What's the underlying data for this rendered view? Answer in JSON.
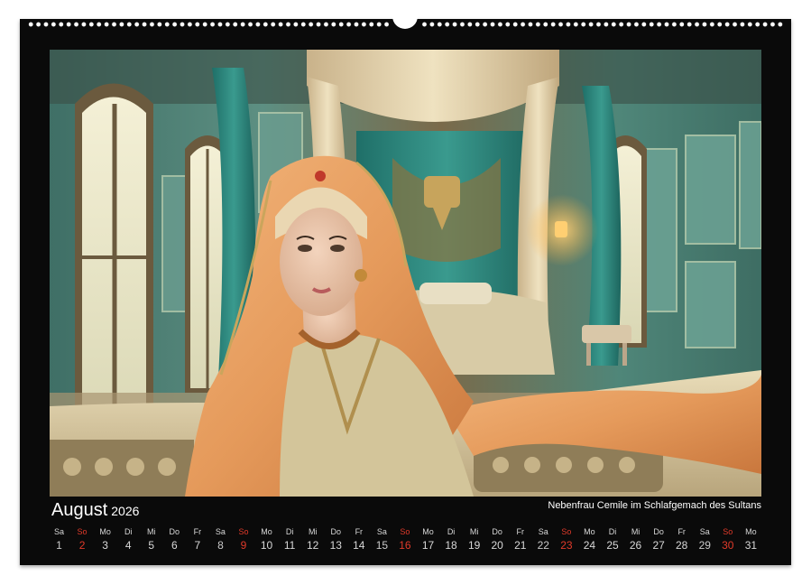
{
  "calendar": {
    "month": "August",
    "year": "2026",
    "caption": "Nebenfrau Cemile im Schlafgemach des Sultans",
    "days": [
      {
        "wd": "Sa",
        "d": "1"
      },
      {
        "wd": "So",
        "d": "2"
      },
      {
        "wd": "Mo",
        "d": "3"
      },
      {
        "wd": "Di",
        "d": "4"
      },
      {
        "wd": "Mi",
        "d": "5"
      },
      {
        "wd": "Do",
        "d": "6"
      },
      {
        "wd": "Fr",
        "d": "7"
      },
      {
        "wd": "Sa",
        "d": "8"
      },
      {
        "wd": "So",
        "d": "9"
      },
      {
        "wd": "Mo",
        "d": "10"
      },
      {
        "wd": "Di",
        "d": "11"
      },
      {
        "wd": "Mi",
        "d": "12"
      },
      {
        "wd": "Do",
        "d": "13"
      },
      {
        "wd": "Fr",
        "d": "14"
      },
      {
        "wd": "Sa",
        "d": "15"
      },
      {
        "wd": "So",
        "d": "16"
      },
      {
        "wd": "Mo",
        "d": "17"
      },
      {
        "wd": "Di",
        "d": "18"
      },
      {
        "wd": "Mi",
        "d": "19"
      },
      {
        "wd": "Do",
        "d": "20"
      },
      {
        "wd": "Fr",
        "d": "21"
      },
      {
        "wd": "Sa",
        "d": "22"
      },
      {
        "wd": "So",
        "d": "23"
      },
      {
        "wd": "Mo",
        "d": "24"
      },
      {
        "wd": "Di",
        "d": "25"
      },
      {
        "wd": "Mi",
        "d": "26"
      },
      {
        "wd": "Do",
        "d": "27"
      },
      {
        "wd": "Fr",
        "d": "28"
      },
      {
        "wd": "Sa",
        "d": "29"
      },
      {
        "wd": "So",
        "d": "30"
      },
      {
        "wd": "Mo",
        "d": "31"
      }
    ]
  },
  "colors": {
    "sunday": "#e03a2a",
    "background": "#0a0a0a"
  }
}
